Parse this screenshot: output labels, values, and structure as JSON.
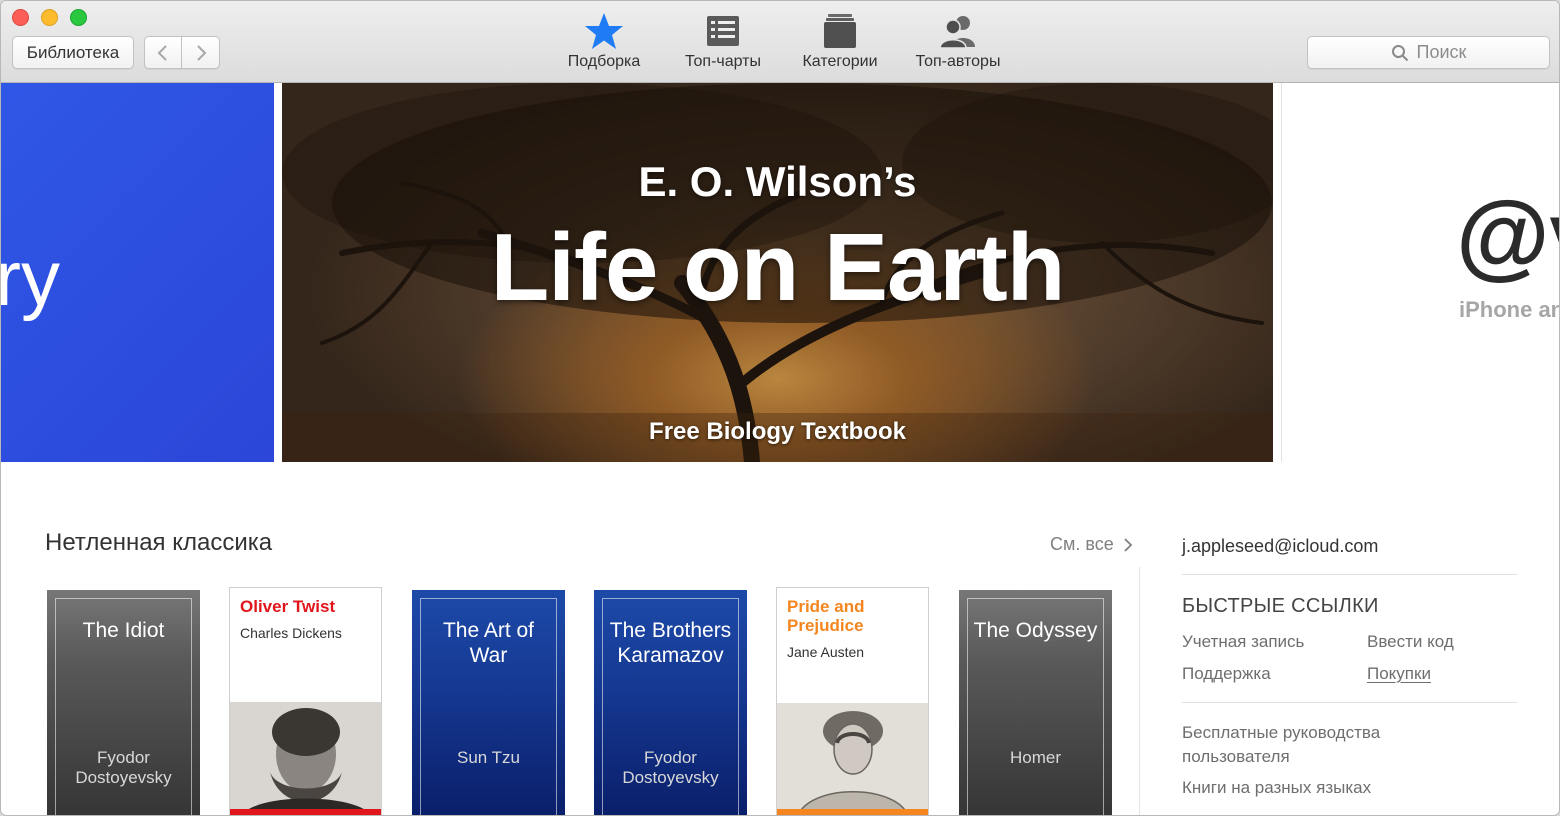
{
  "toolbar": {
    "library_label": "Библиотека",
    "tabs": [
      {
        "label": "Подборка",
        "icon": "star-icon",
        "active": true
      },
      {
        "label": "Топ-чарты",
        "icon": "list-icon"
      },
      {
        "label": "Категории",
        "icon": "books-icon"
      },
      {
        "label": "Топ-авторы",
        "icon": "people-icon"
      }
    ],
    "search_placeholder": "Поиск"
  },
  "banner": {
    "left_fragment": "ry",
    "main": {
      "kicker": "E. O. Wilson’s",
      "title": "Life on Earth",
      "subtitle": "Free Biology Textbook"
    },
    "right": {
      "symbol": "@v",
      "text": "iPhone an"
    }
  },
  "classics": {
    "title": "Нетленная классика",
    "see_all": "См. все",
    "books": [
      {
        "title": "The Idiot",
        "author": "Fyodor Dostoyevsky"
      },
      {
        "title": "Oliver Twist",
        "author": "Charles Dickens"
      },
      {
        "title": "The Art of War",
        "author": "Sun Tzu"
      },
      {
        "title": "The Brothers Karamazov",
        "author": "Fyodor Dostoyevsky"
      },
      {
        "title": "Pride and Prejudice",
        "author": "Jane Austen"
      },
      {
        "title": "The Odyssey",
        "author": "Homer"
      }
    ]
  },
  "sidebar": {
    "account": "j.appleseed@icloud.com",
    "quick_links_title": "БЫСТРЫЕ ССЫЛКИ",
    "quick_links": [
      "Учетная запись",
      "Ввести код",
      "Поддержка",
      "Покупки"
    ],
    "links": [
      "Бесплатные руководства пользователя",
      "Книги на разных языках"
    ]
  },
  "colors": {
    "accent_blue": "#1f7cf4",
    "oliver_red": "#e0161c",
    "pride_orange": "#f5861f"
  }
}
